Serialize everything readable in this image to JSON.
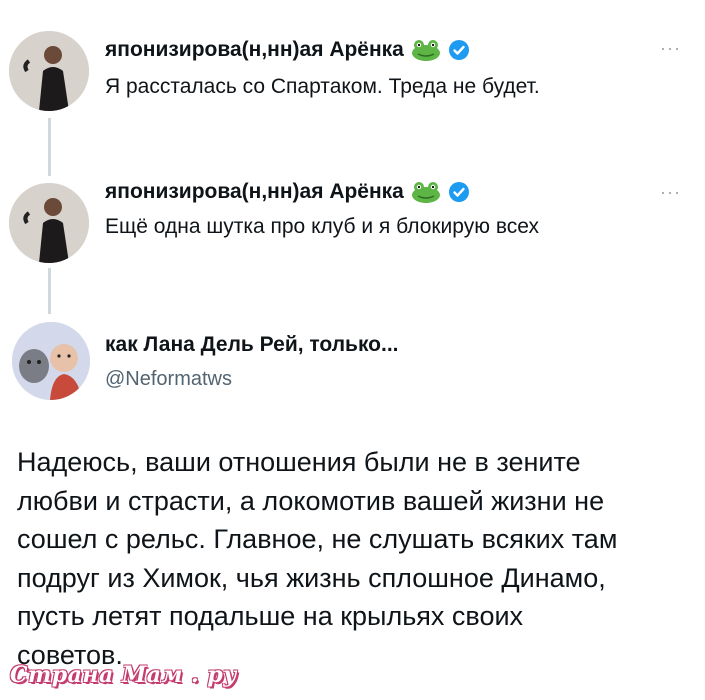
{
  "tweets": [
    {
      "author_name": "японизирова(н,нн)ая Арёнка",
      "text": "Я рассталась со Спартаком. Треда не будет.",
      "more": "···"
    },
    {
      "author_name": "японизирова(н,нн)ая Арёнка",
      "text": "Ещё одна шутка про клуб и я блокирую всех",
      "more": "···"
    }
  ],
  "quote": {
    "author_name": "как Лана Дель Рей, только...",
    "handle": "@Neformatws",
    "lines": [
      "Надеюсь, ваши отношения были не в зените",
      "любви и страсти, а локомотив вашей жизни не",
      "сошел с рельс. Главное, не слушать всяких там",
      "подруг из Химок, чья жизнь сплошное Динамо,",
      "пусть летят подальше на крыльях своих",
      "советов."
    ]
  },
  "watermark": "Страна Мам . ру",
  "colors": {
    "verified": "#1d9bf0",
    "thread_line": "#cfd9de",
    "secondary_text": "#536471",
    "watermark": "#c43b6e"
  },
  "icons": [
    "frog-emoji-icon",
    "verified-badge-icon",
    "more-options-icon"
  ]
}
